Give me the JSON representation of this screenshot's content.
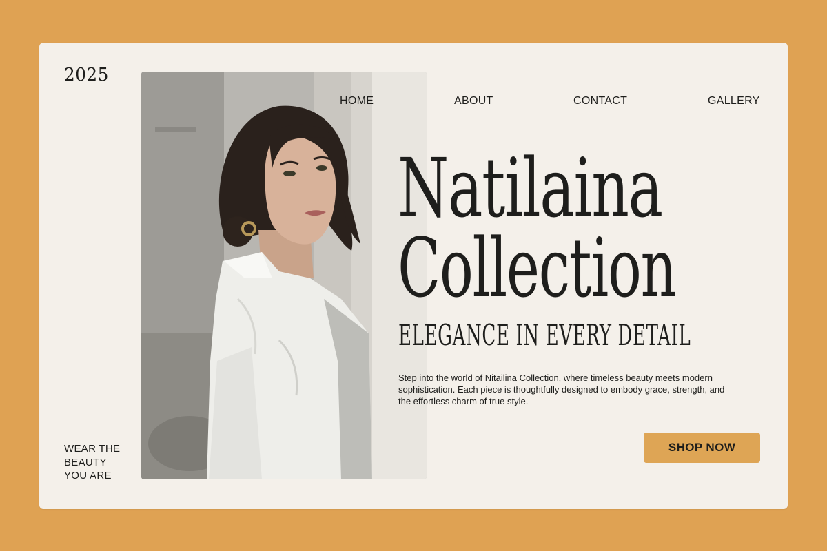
{
  "year": "2025",
  "nav": {
    "items": [
      {
        "label": "HOME"
      },
      {
        "label": "ABOUT"
      },
      {
        "label": "CONTACT"
      },
      {
        "label": "GALLERY"
      }
    ]
  },
  "hero": {
    "title_line1": "Natilaina",
    "title_line2": "Collection",
    "subtitle": "ELEGANCE IN EVERY DETAIL",
    "description": "Step into the world of Nitailina Collection, where timeless beauty meets modern sophistication. Each piece is thoughtfully designed to embody grace, strength, and the effortless charm of true style.",
    "cta_label": "SHOP NOW"
  },
  "tagline": {
    "line1": "WEAR THE",
    "line2": "BEAUTY",
    "line3": "YOU ARE"
  },
  "photo": {
    "subject": "model-portrait"
  },
  "colors": {
    "background": "#dfa253",
    "card": "#f4f0ea",
    "text": "#1e1e1c",
    "button": "#dea555"
  }
}
